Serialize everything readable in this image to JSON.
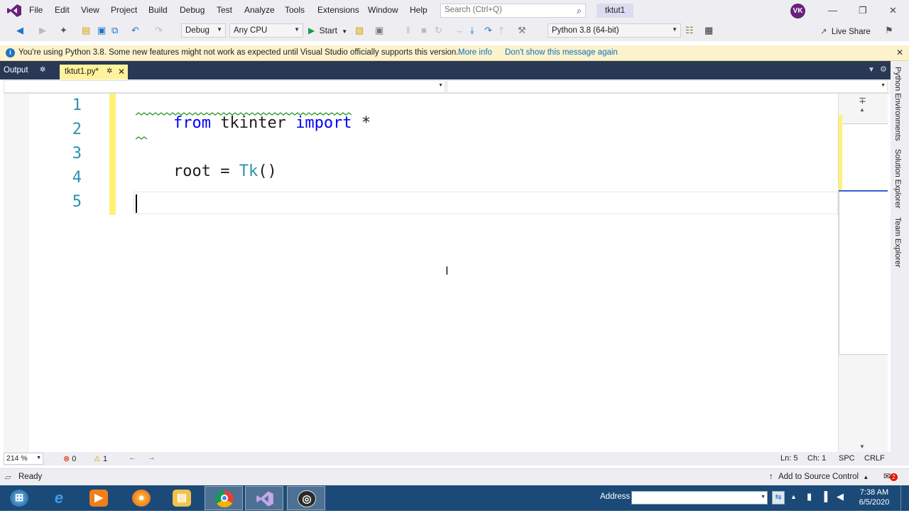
{
  "menu": {
    "items": [
      "File",
      "Edit",
      "View",
      "Project",
      "Build",
      "Debug",
      "Test",
      "Analyze",
      "Tools",
      "Extensions",
      "Window",
      "Help"
    ]
  },
  "search": {
    "placeholder": "Search (Ctrl+Q)"
  },
  "solution_name": "tktut1",
  "user_initials": "VK",
  "toolbar": {
    "config": "Debug",
    "platform": "Any CPU",
    "start_label": "Start",
    "python_env": "Python 3.8 (64-bit)",
    "live_share": "Live Share"
  },
  "infobar": {
    "message": "You're using Python 3.8. Some new features might not work as expected until Visual Studio officially supports this version.",
    "link_more": "More info",
    "link_dismiss": "Don't show this message again"
  },
  "tabs": {
    "output": "Output",
    "active_file": "tktut1.py*"
  },
  "editor": {
    "line_numbers": [
      "1",
      "2",
      "3",
      "4",
      "5"
    ],
    "line1": {
      "kw1": "from",
      "mod": " tkinter ",
      "kw2": "import",
      "rest": " *"
    },
    "line3": {
      "var": "root = ",
      "cls": "Tk",
      "rest": "()"
    }
  },
  "side_tabs": [
    "Python Environments",
    "Solution Explorer",
    "Team Explorer"
  ],
  "editor_status": {
    "zoom": "214 %",
    "errors": "0",
    "warnings": "1",
    "ln": "Ln: 5",
    "ch": "Ch: 1",
    "spc": "SPC",
    "eol": "CRLF"
  },
  "statusbar": {
    "ready": "Ready",
    "source_control": "Add to Source Control",
    "notifications": "2"
  },
  "taskbar": {
    "address_label": "Address",
    "time": "7:38 AM",
    "date": "6/5/2020",
    "apps": [
      "windows-start",
      "internet-explorer",
      "media-player",
      "firefox",
      "file-explorer",
      "chrome",
      "visual-studio",
      "obs"
    ]
  }
}
